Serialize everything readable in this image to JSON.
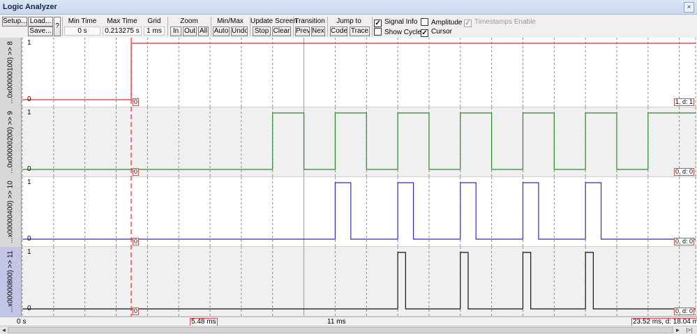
{
  "window": {
    "title": "Logic Analyzer",
    "close_glyph": "×"
  },
  "toolbar": {
    "setup_label": "Setup...",
    "load_label": "Load...",
    "save_label": "Save...",
    "help_label": "?",
    "min_time": {
      "label": "Min Time",
      "value": "0 s"
    },
    "max_time": {
      "label": "Max Time",
      "value": "0.213275 s"
    },
    "grid": {
      "label": "Grid",
      "value": "1 ms"
    },
    "zoom": {
      "label": "Zoom",
      "in": "In",
      "out": "Out",
      "all": "All"
    },
    "minmax": {
      "label": "Min/Max",
      "auto": "Auto",
      "undo": "Undo"
    },
    "update": {
      "label": "Update Screen",
      "stop": "Stop",
      "clear": "Clear"
    },
    "transition": {
      "label": "Transition",
      "prev": "Prev",
      "next": "Next"
    },
    "jump": {
      "label": "Jump to",
      "code": "Code",
      "trace": "Trace"
    },
    "checks": {
      "signal_info": {
        "label": "Signal Info",
        "checked": true
      },
      "show_cycles": {
        "label": "Show Cycles",
        "checked": false
      },
      "amplitude": {
        "label": "Amplitude",
        "checked": false
      },
      "cursor": {
        "label": "Cursor",
        "checked": true
      },
      "timestamps": {
        "label": "Timestamps Enable",
        "checked": true,
        "disabled": true
      }
    }
  },
  "signals": [
    {
      "name": "...0x00000100) >> 8",
      "color": "#e8262c",
      "high_label": "1",
      "low_label": "0",
      "cursor_value": "0",
      "end_info": "1,  d: 1",
      "edges": [
        5.48
      ],
      "initial": 0,
      "selected": false
    },
    {
      "name": "...0x00000200) >> 9",
      "color": "#2b8a2b",
      "high_label": "1",
      "low_label": "0",
      "cursor_value": "0",
      "end_info": "0,  d: 0",
      "edges": [
        10.0,
        11.0,
        12.0,
        13.0,
        14.0,
        15.0,
        16.0,
        17.0,
        18.0,
        19.0,
        20.0,
        21.0,
        22.0
      ],
      "initial": 0,
      "selected": false
    },
    {
      "name": "...x00000400) >> 10",
      "color": "#2d2dc0",
      "high_label": "1",
      "low_label": "0",
      "cursor_value": "0",
      "end_info": "0,  d: 0",
      "edges": [
        12.0,
        12.5,
        14.0,
        14.5,
        16.0,
        16.5,
        18.0,
        18.5,
        20.0,
        20.5
      ],
      "initial": 0,
      "selected": false
    },
    {
      "name": "...x00000800) >> 11",
      "color": "#111111",
      "high_label": "1",
      "low_label": "0",
      "cursor_value": "0",
      "end_info": "0,  d: 0",
      "edges": [
        14.0,
        14.25,
        16.0,
        16.25,
        18.0,
        18.25,
        20.0,
        20.25
      ],
      "initial": 0,
      "selected": true
    }
  ],
  "timeline": {
    "start_ms": 2.0,
    "end_ms": 23.52,
    "grid_ms": 1,
    "cursor_ms": 5.48,
    "solid_line_ms": 11,
    "labels": {
      "left": "0 s",
      "cursor": "5.48 ms",
      "middle": "11 ms",
      "right": "23.52 ms,  d: 18.04 ms"
    }
  },
  "scroll": {
    "left": "◄",
    "right": "►",
    "end": "|>|"
  }
}
